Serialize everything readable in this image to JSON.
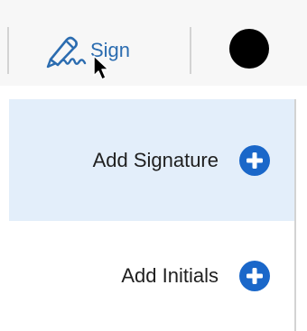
{
  "toolbar": {
    "sign_label": "Sign",
    "sign_icon": "signature-pen-icon",
    "color_swatch": "#000000",
    "accent_color": "#2b6cb0"
  },
  "menu": {
    "items": [
      {
        "label": "Add Signature",
        "icon": "plus-circle-icon",
        "highlighted": true
      },
      {
        "label": "Add Initials",
        "icon": "plus-circle-icon",
        "highlighted": false
      }
    ],
    "highlight_color": "#e3eefa",
    "icon_color": "#1a67c9"
  }
}
